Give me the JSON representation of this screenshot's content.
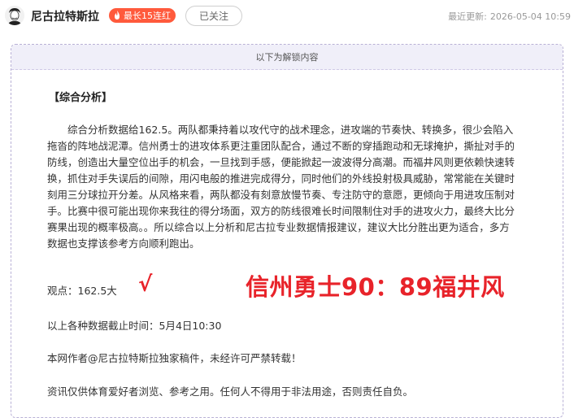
{
  "header": {
    "author_name": "尼古拉特斯拉",
    "streak_badge": "最长15连红",
    "follow_button": "已关注",
    "updated_label": "最近更新:",
    "updated_time": "2026-05-04 10:59"
  },
  "panel": {
    "unlock_notice": "以下为解锁内容",
    "section_title": "【综合分析】",
    "analysis_lines": [
      "综合分析数据给162.5。两队都秉持着以攻代守的战术理念，进攻端的节奏快、转换多，很少会陷入",
      "拖沓的阵地战泥潭。信州勇士的进攻体系更注重团队配合，通过不断的穿插跑动和无球掩护，撕扯对手的",
      "防线，创造出大量空位出手的机会，一旦找到手感，便能掀起一波波得分高潮。而福井风则更依赖快速转",
      "换，抓住对手失误后的间隙，用闪电般的推进完成得分，同时他们的外线投射极具威胁，常常能在关键时",
      "刻用三分球拉开分差。从风格来看，两队都没有刻意放慢节奏、专注防守的意愿，更倾向于用进攻压制对",
      "手。比赛中很可能出现你来我往的得分场面，双方的防线很难长时间限制住对手的进攻火力，最终大比分",
      "赛果出现的概率极高。。所以综合以上分析和尼古拉专业数据情报建议，建议大比分胜出更为适合，多方",
      "数据也支撑该参考方向顺利跑出。"
    ],
    "viewpoint": "观点：162.5大",
    "check_mark": "√",
    "prediction": "信州勇士90：89福井风",
    "deadline": "以上各种数据截止时间：5月4日10:30",
    "copyright": "本网作者@尼古拉特斯拉独家稿件，未经许可严禁转载！",
    "disclaimer": "资讯仅供体育爱好者浏览、参考之用。任何人不得用于非法用途，否则责任自负。"
  }
}
